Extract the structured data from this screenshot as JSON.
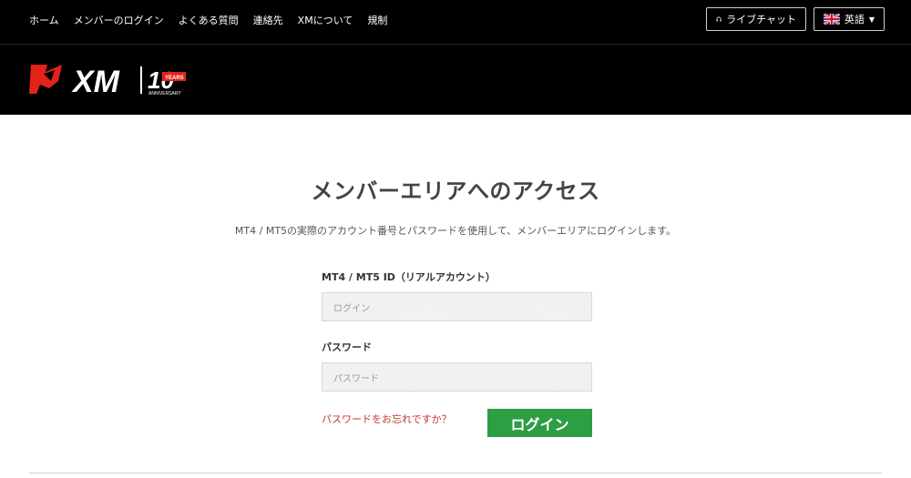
{
  "topnav": {
    "items": [
      "ホーム",
      "メンバーのログイン",
      "よくある質問",
      "連絡先",
      "XMについて",
      "規制"
    ],
    "live_chat": "ライブチャット",
    "language": "英語"
  },
  "brand": {
    "logo_text": "XM",
    "anniversary_number": "10",
    "anniversary_small": "YEARS",
    "anniversary_label": "ANNIVERSARY"
  },
  "main": {
    "title": "メンバーエリアへのアクセス",
    "subtitle": "MT4 / MT5の実際のアカウント番号とパスワードを使用して、メンバーエリアにログインします。",
    "id_label": "MT4 / MT5 ID（リアルアカウント）",
    "id_placeholder": "ログイン",
    "password_label": "パスワード",
    "password_placeholder": "パスワード",
    "forgot_link": "パスワードをお忘れですか？",
    "login_button": "ログイン"
  },
  "colors": {
    "header_bg": "#000000",
    "brand_red": "#e2231a",
    "login_green": "#2e9e45",
    "link_red": "#c0392b"
  }
}
